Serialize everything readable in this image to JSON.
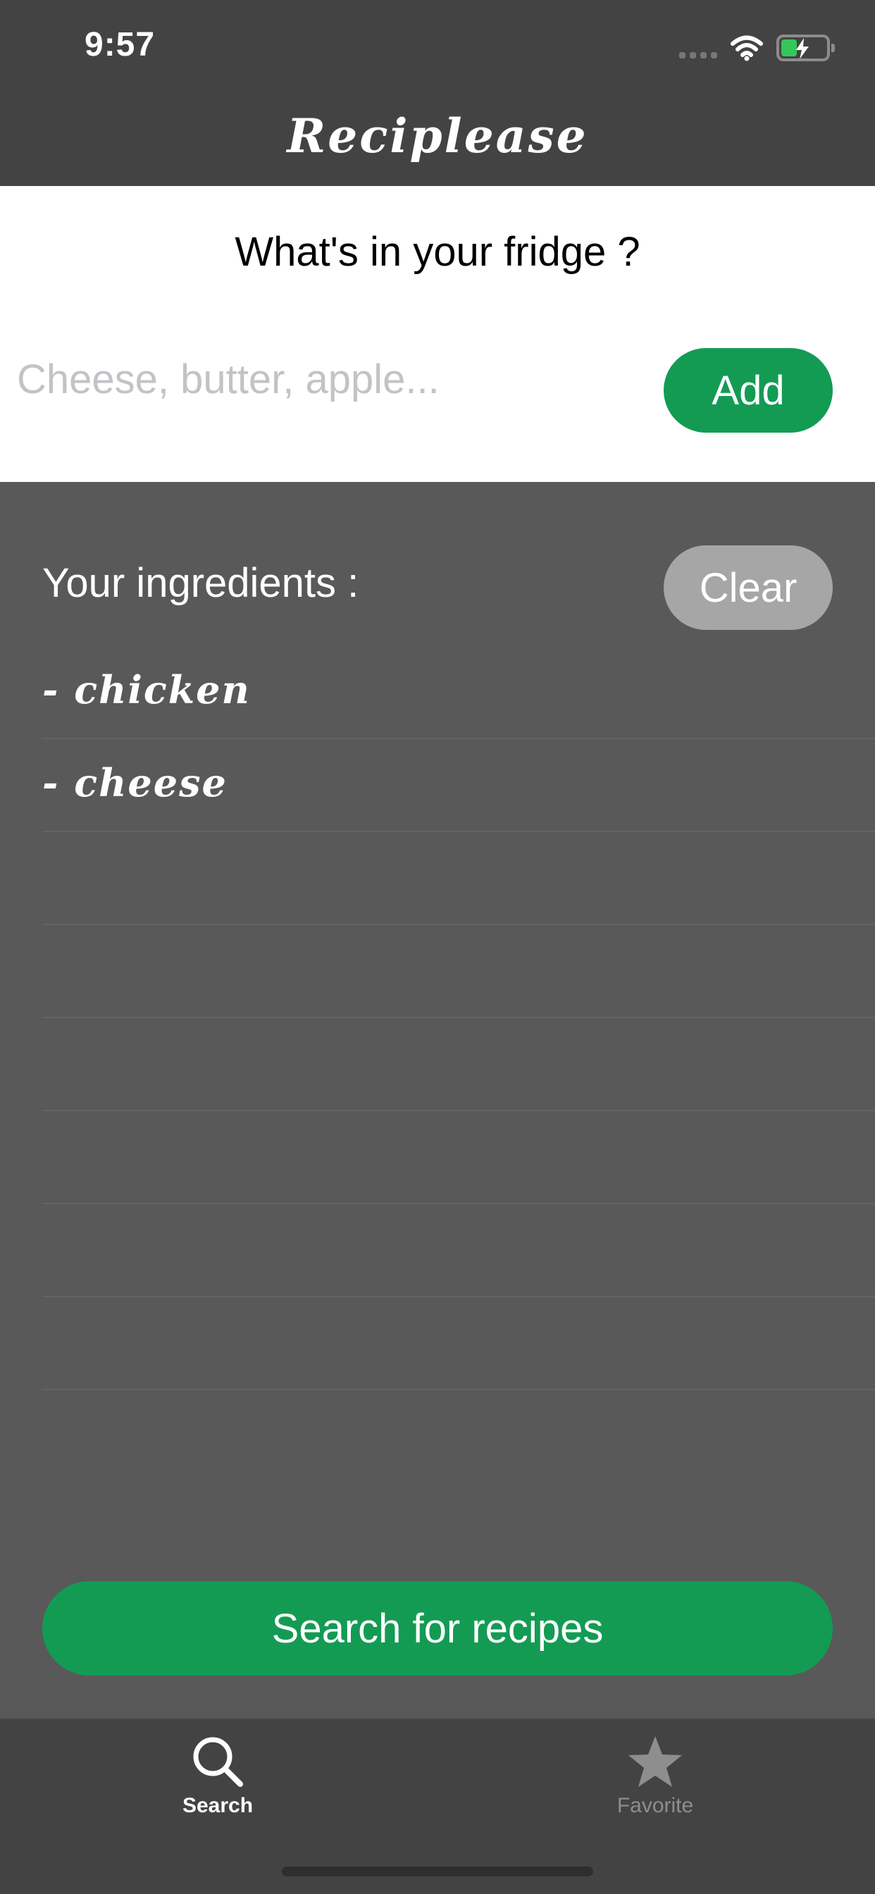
{
  "status_bar": {
    "time": "9:57",
    "signal_icon": "cellular-signal-icon",
    "wifi_icon": "wifi-icon",
    "battery_icon": "battery-charging-icon"
  },
  "nav": {
    "title": "Reciplease"
  },
  "search": {
    "question": "What's in your fridge ?",
    "input_value": "",
    "input_placeholder": "Cheese, butter, apple...",
    "add_label": "Add"
  },
  "ingredients": {
    "header": "Your ingredients :",
    "clear_label": "Clear",
    "items": [
      {
        "label": "- chicken"
      },
      {
        "label": "- cheese"
      },
      {
        "label": ""
      },
      {
        "label": ""
      },
      {
        "label": ""
      },
      {
        "label": ""
      },
      {
        "label": ""
      },
      {
        "label": ""
      },
      {
        "label": ""
      }
    ]
  },
  "search_button_label": "Search for recipes",
  "tabs": [
    {
      "label": "Search",
      "icon": "search-icon",
      "selected": true
    },
    {
      "label": "Favorite",
      "icon": "star-icon",
      "selected": false
    }
  ],
  "colors": {
    "accent_green": "#139b54",
    "clear_gray": "#a6a6a6",
    "bar_dark": "#434343",
    "background": "#595959"
  }
}
